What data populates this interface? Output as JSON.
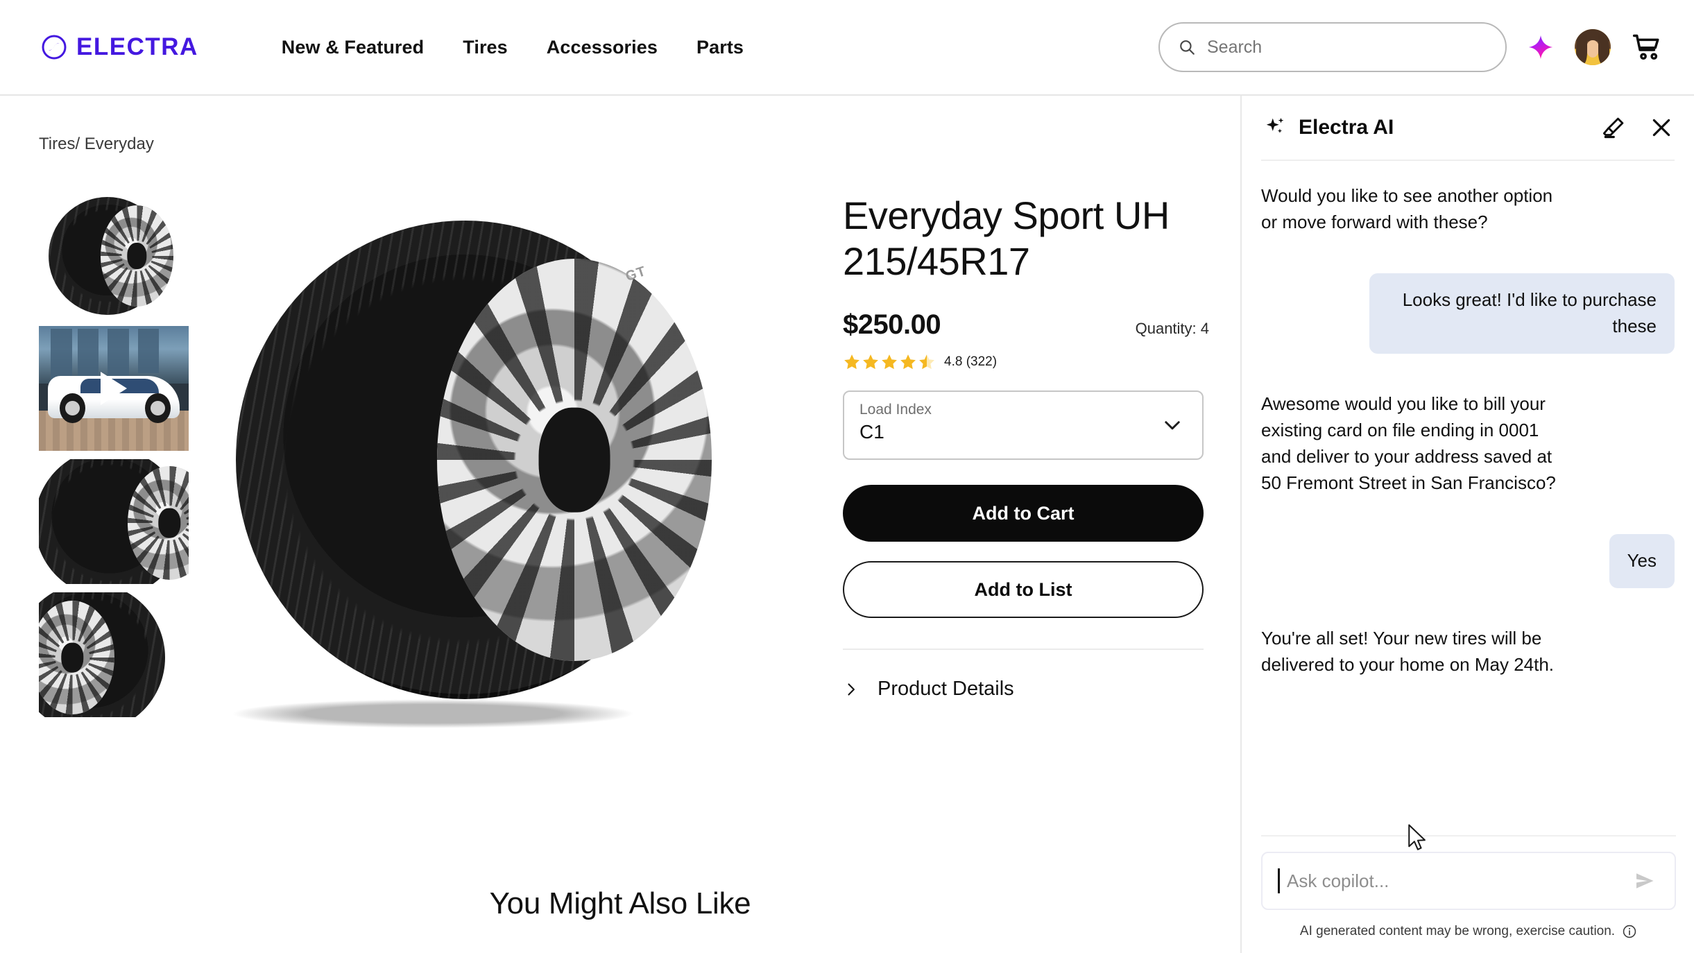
{
  "header": {
    "logo_text": "ELECTRA",
    "logo_color": "#4418e0",
    "logo_icon": "electra-circle-logo",
    "nav": [
      {
        "label": "New & Featured"
      },
      {
        "label": "Tires"
      },
      {
        "label": "Accessories"
      },
      {
        "label": "Parts"
      }
    ],
    "search": {
      "placeholder": "Search",
      "value": "",
      "icon": "search-icon"
    },
    "sparkle_icon": "ai-sparkle-icon",
    "avatar_icon": "user-avatar",
    "cart_icon": "shopping-cart-icon"
  },
  "breadcrumb": "Tires/ Everyday",
  "gallery": {
    "thumbnails": [
      {
        "name": "tire-front-view",
        "type": "image"
      },
      {
        "name": "tire-video-preview",
        "type": "video"
      },
      {
        "name": "tire-tread-closeup",
        "type": "image"
      },
      {
        "name": "tire-side-profile",
        "type": "image"
      }
    ],
    "hero": {
      "name": "tire-hero-image",
      "brand_mark": "GT"
    }
  },
  "product": {
    "title": "Everyday Sport UH 215/45R17",
    "price": "$250.00",
    "quantity_label": "Quantity: 4",
    "rating_value": 4.8,
    "rating_text": "4.8 (322)",
    "review_count": 322,
    "stars_filled": 4,
    "stars_half": 1,
    "select": {
      "label": "Load Index",
      "value": "C1",
      "chevron_icon": "chevron-down-icon"
    },
    "add_to_cart_label": "Add to Cart",
    "add_to_list_label": "Add to List",
    "details_label": "Product Details",
    "details_chevron_icon": "chevron-right-icon"
  },
  "also_like_heading": "You Might Also Like",
  "ai_panel": {
    "title": "Electra AI",
    "title_icon": "sparkle-icon",
    "clear_icon": "eraser-icon",
    "close_icon": "close-icon",
    "messages": [
      {
        "role": "bot",
        "text": "Would you like to see another option or move forward with these?"
      },
      {
        "role": "user",
        "text": "Looks great! I'd like to purchase these"
      },
      {
        "role": "bot",
        "text": "Awesome would you like to bill your existing card on file ending in 0001 and deliver to your address saved at 50 Fremont Street in San Francisco?"
      },
      {
        "role": "user",
        "text": "Yes"
      },
      {
        "role": "bot",
        "text": "You're all set! Your new tires will be delivered to your home on May 24th."
      }
    ],
    "composer": {
      "placeholder": "Ask copilot...",
      "value": "",
      "send_icon": "send-icon"
    },
    "disclaimer": "AI generated content may be wrong, exercise caution.",
    "disclaimer_icon": "info-icon"
  },
  "colors": {
    "brand": "#4418e0",
    "user_bubble": "#e2e8f4",
    "cta": "#0b0b0b",
    "star": "#f5b821"
  }
}
